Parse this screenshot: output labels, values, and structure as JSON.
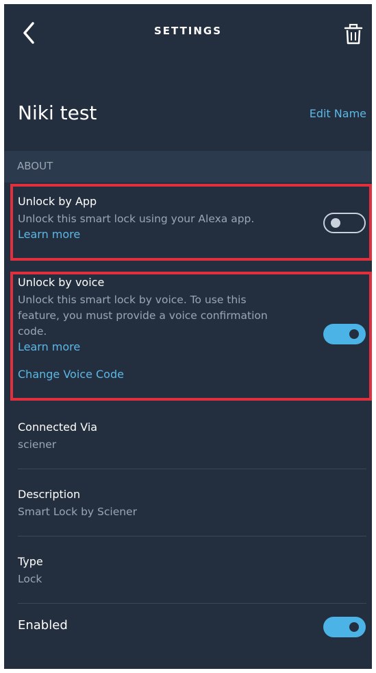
{
  "header": {
    "title": "SETTINGS",
    "back_icon": "chevron-left-icon",
    "delete_icon": "trash-icon"
  },
  "device": {
    "name": "Niki test",
    "edit_label": "Edit Name"
  },
  "about": {
    "section_label": "ABOUT",
    "unlock_by_app": {
      "title": "Unlock by App",
      "description": "Unlock this smart lock using your Alexa app.",
      "learn_more": "Learn more",
      "enabled": false
    },
    "unlock_by_voice": {
      "title": "Unlock by voice",
      "description_line1": "Unlock this smart lock by voice. To use this",
      "description_line2": "feature, you must provide a voice confirmation",
      "description_line3": "code.",
      "learn_more": "Learn more",
      "change_code": "Change Voice Code",
      "enabled": true
    }
  },
  "info": {
    "connected_via_label": "Connected Via",
    "connected_via_value": "sciener",
    "description_label": "Description",
    "description_value": "Smart Lock by Sciener",
    "type_label": "Type",
    "type_value": "Lock",
    "enabled_label": "Enabled",
    "enabled": true
  },
  "colors": {
    "background": "#232f3e",
    "accent": "#5cb8e6",
    "toggle_on": "#4bb3e6",
    "highlight": "#e0303d",
    "muted_text": "#9aa6b4"
  }
}
